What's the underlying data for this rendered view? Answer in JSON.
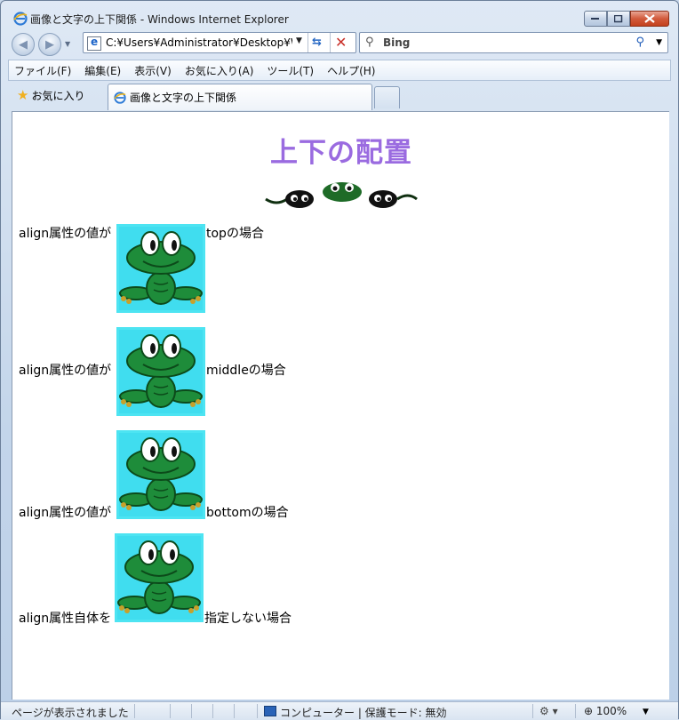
{
  "window": {
    "title": "画像と文字の上下関係 - Windows Internet Explorer"
  },
  "navigation": {
    "address": "C:¥Users¥Administrator¥Desktop¥W",
    "search_placeholder": "Bing"
  },
  "menu": {
    "items": [
      "ファイル(F)",
      "編集(E)",
      "表示(V)",
      "お気に入り(A)",
      "ツール(T)",
      "ヘルプ(H)"
    ]
  },
  "favorites": {
    "label": "お気に入り"
  },
  "tab": {
    "title": "画像と文字の上下関係"
  },
  "page": {
    "heading": "上下の配置",
    "rows": [
      {
        "before": "align属性の値が",
        "after": "topの場合"
      },
      {
        "before": "align属性の値が",
        "after": "middleの場合"
      },
      {
        "before": "align属性の値が",
        "after": "bottomの場合"
      },
      {
        "before": "align属性自体を",
        "after": "指定しない場合"
      }
    ]
  },
  "status": {
    "text": "ページが表示されました",
    "zone": "コンピューター | 保護モード: 無効",
    "zoom": "100%"
  },
  "colors": {
    "heading": "#9a6be0",
    "frog_bg": "#4de4f2",
    "frog_body": "#1e8c3a"
  },
  "icons": [
    "ie-icon",
    "back-icon",
    "forward-icon",
    "refresh-icon",
    "stop-icon",
    "search-icon",
    "star-icon",
    "frog-image",
    "tadpole-icon"
  ]
}
